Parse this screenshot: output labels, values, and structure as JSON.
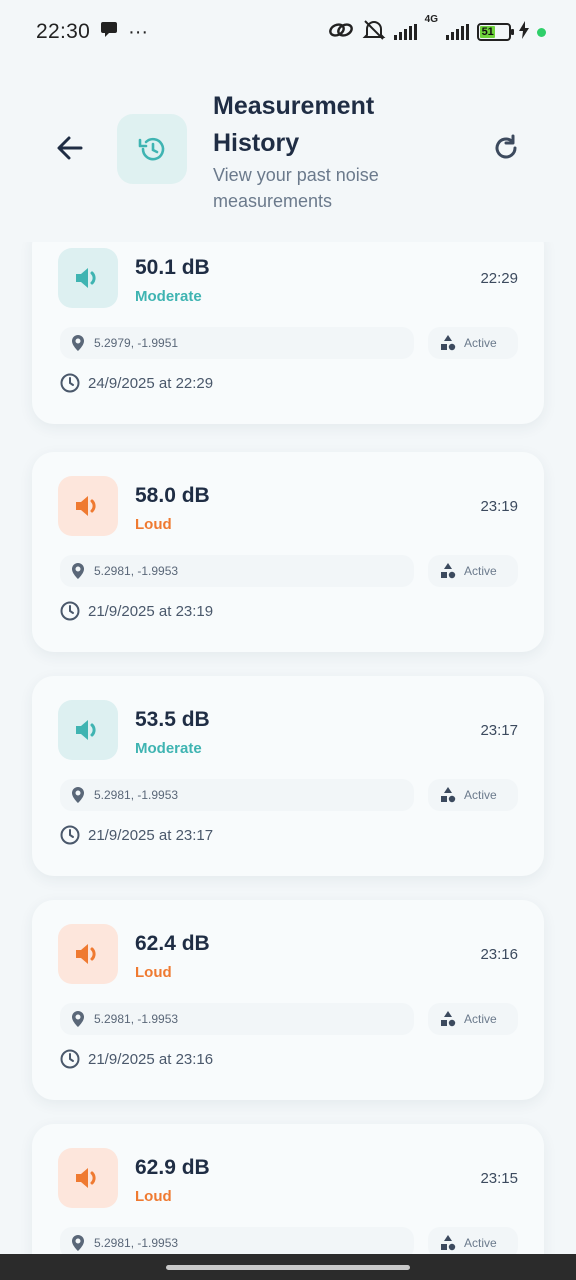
{
  "status_bar": {
    "time": "22:30",
    "dots": "···",
    "network": "4G",
    "battery": "51"
  },
  "header": {
    "title": "Measurement History",
    "subtitle": "View your past noise measurements"
  },
  "colors": {
    "moderate": "#3fb4b2",
    "loud": "#ef7a31",
    "moderate_bg": "#ddf0f1",
    "loud_bg": "#fde6dc"
  },
  "measurements": [
    {
      "db": "50.1 dB",
      "level": "Moderate",
      "time": "22:29",
      "location": "5.2979, -1.9951",
      "status": "Active",
      "date": "24/9/2025 at 22:29"
    },
    {
      "db": "58.0 dB",
      "level": "Loud",
      "time": "23:19",
      "location": "5.2981, -1.9953",
      "status": "Active",
      "date": "21/9/2025 at 23:19"
    },
    {
      "db": "53.5 dB",
      "level": "Moderate",
      "time": "23:17",
      "location": "5.2981, -1.9953",
      "status": "Active",
      "date": "21/9/2025 at 23:17"
    },
    {
      "db": "62.4 dB",
      "level": "Loud",
      "time": "23:16",
      "location": "5.2981, -1.9953",
      "status": "Active",
      "date": "21/9/2025 at 23:16"
    },
    {
      "db": "62.9 dB",
      "level": "Loud",
      "time": "23:15",
      "location": "5.2981, -1.9953",
      "status": "Active",
      "date": ""
    }
  ]
}
